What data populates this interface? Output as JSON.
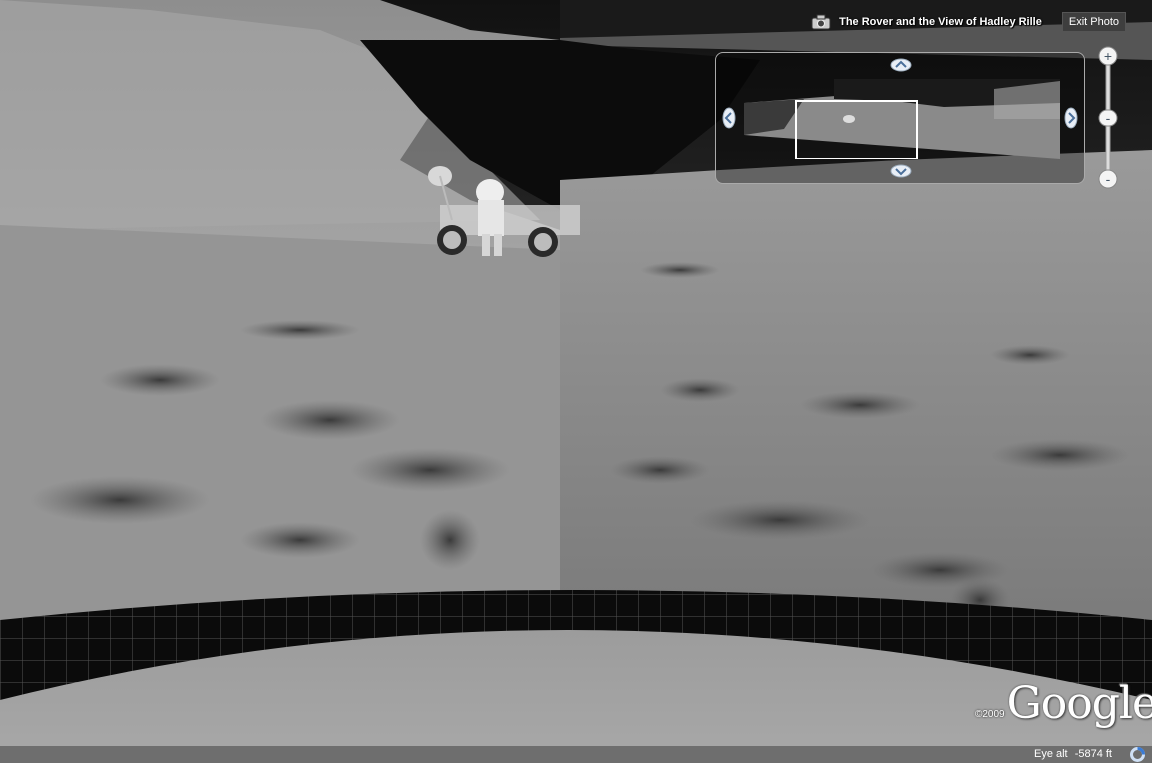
{
  "photo": {
    "title": "The Rover and the View of Hadley Rille",
    "exit_label": "Exit Photo"
  },
  "navigator": {
    "up": "chevron-up-icon",
    "down": "chevron-down-icon",
    "left": "chevron-left-icon",
    "right": "chevron-right-icon"
  },
  "zoom": {
    "plus": "+",
    "minus_mid": "-",
    "minus_bottom": "-"
  },
  "logo": {
    "copyright": "©2009",
    "brand": "Google"
  },
  "status": {
    "eye_alt_label": "Eye alt",
    "eye_alt_value": "-5874 ft"
  }
}
